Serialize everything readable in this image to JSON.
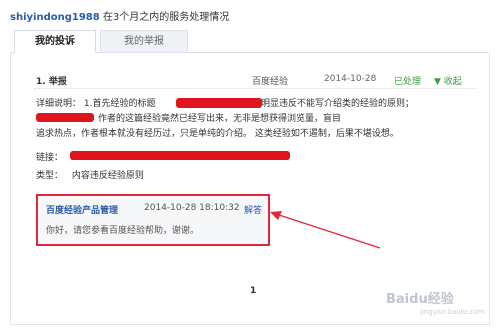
{
  "header": {
    "username": "shiyindong1988",
    "text": "在3个月之内的服务处理情况"
  },
  "tabs": [
    {
      "label": "我的投诉"
    },
    {
      "label": "我的举报"
    }
  ],
  "complaint": {
    "title": "1. 举报",
    "source": "百度经验",
    "date": "2014-10-28",
    "status": "已处理",
    "collapse": "▼ 收起",
    "detail_line1": "详细说明： 1.首先经验的标题",
    "detail_line1b": "】，明显违反不能写介绍类的经验的原则；",
    "detail_line2": "作者的这篇经验竟然已经写出来，无非是想获得浏览量，盲目",
    "detail_line3": "追求热点，作者根本就没有经历过，只是单纯的介绍。 这类经验如不遏制，后果不堪设想。",
    "link_label": "链接：",
    "type_label": "类型：",
    "type_value": "内容违反经验原则"
  },
  "reply": {
    "name": "百度经验产品管理",
    "time": "2014-10-28 18:10:32",
    "answer_label": "解答",
    "message": "你好，请您参看百度经验帮助，谢谢。"
  },
  "pagination": {
    "current": "1"
  },
  "watermark": {
    "main": "Baidu经验",
    "sub": "jingyan.baidu.com"
  },
  "colors": {
    "highlight_red": "#e3263a",
    "link_blue": "#2a5caa",
    "status_green": "#3f9b3f"
  }
}
